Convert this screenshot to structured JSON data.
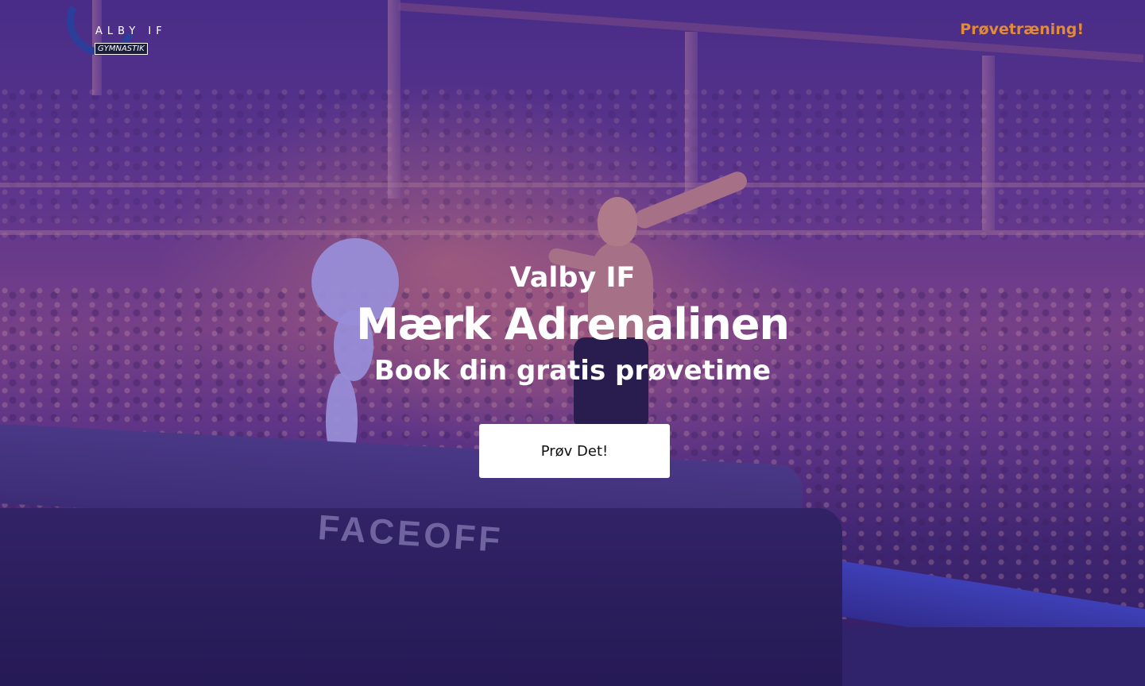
{
  "header": {
    "logo_text": "ALBY IF",
    "logo_subtext": "GYMNASTIK",
    "nav_link": "Prøvetræning!"
  },
  "hero": {
    "eyebrow": "Valby IF",
    "headline": "Mærk Adrenalinen",
    "subheadline": "Book din gratis prøvetime",
    "cta_label": "Prøv Det!",
    "mat_brand": "FACEOFF"
  },
  "colors": {
    "nav_link": "#e08a3a",
    "overlay": "#4a2f86",
    "cta_background": "#ffffff",
    "logo_blue": "#2b3e9a"
  }
}
